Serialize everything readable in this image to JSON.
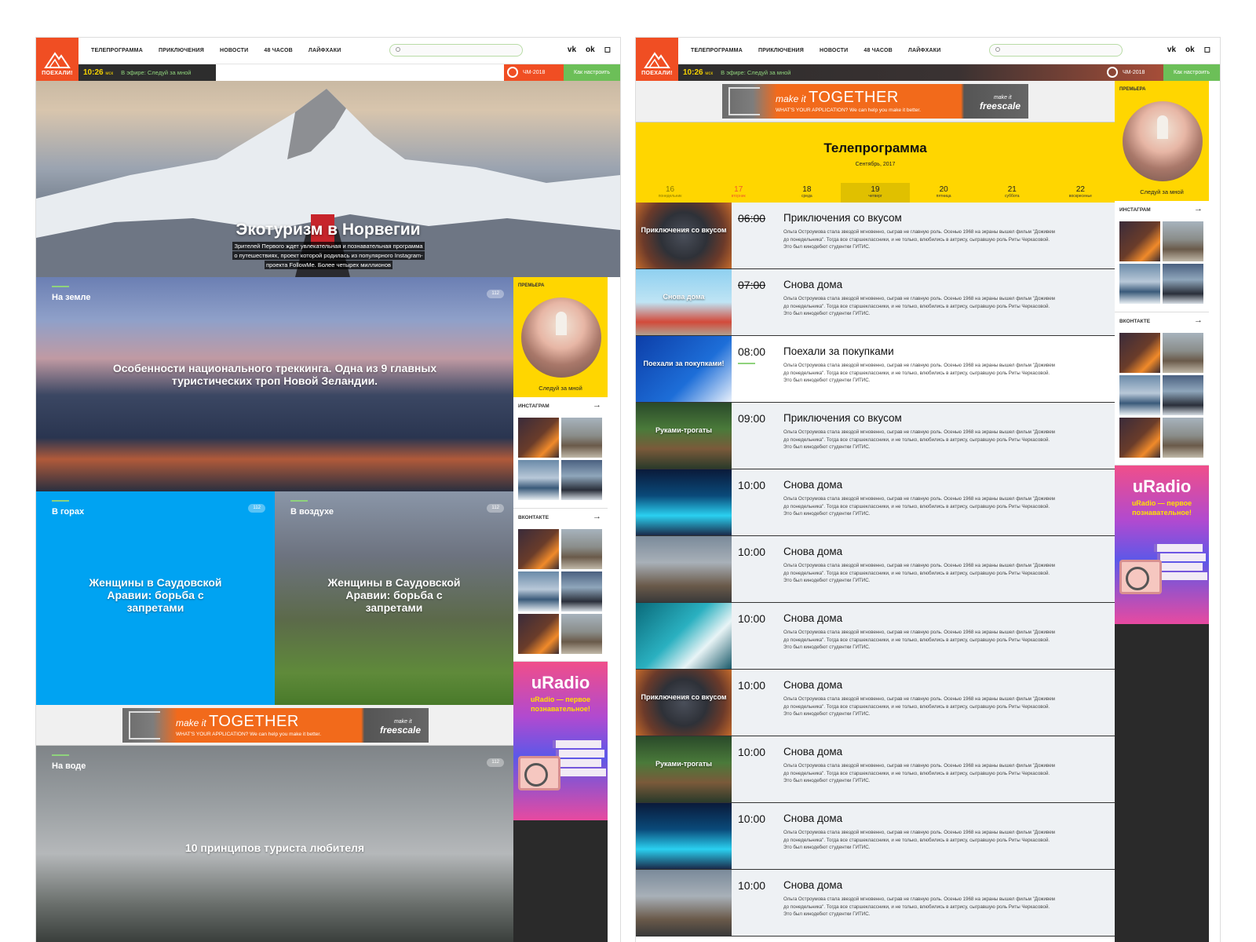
{
  "nav": {
    "logo_text": "ПОЕХАЛИ!",
    "menu": [
      "ТЕЛЕПРОГРАММА",
      "ПРИКЛЮЧЕНИЯ",
      "НОВОСТИ",
      "48 ЧАСОВ",
      "ЛАЙФХАКИ"
    ],
    "search_placeholder": "",
    "social": [
      "vk-icon",
      "odnoklassniki-icon",
      "instagram-icon"
    ]
  },
  "live": {
    "time": "10:26",
    "tz": "мск",
    "on_air": "В эфире: Следуй за мной",
    "cup": "ЧМ-2018",
    "setup": "Как настроить"
  },
  "home": {
    "hero": {
      "title": "Экотуризм в Норвегии",
      "text": "Зрителей Первого ждет увлекательная и познавательная программа о путешествиях, проект которой родилась из популярного Instagram-проекта FollowMe. Более четырех миллионов"
    },
    "tiles": {
      "land": {
        "label": "На земле",
        "count": "112",
        "title": "Особенности национального треккинга. Одна из 9 главных туристических троп Новой Зеландии."
      },
      "mountains": {
        "label": "В горах",
        "count": "112",
        "title": "Женщины в Саудовской Аравии: борьба с запретами"
      },
      "air": {
        "label": "В воздухе",
        "count": "112",
        "title": "Женщины в Саудовской Аравии: борьба с запретами"
      },
      "water": {
        "label": "На воде",
        "count": "112",
        "title": "10 принципов туриста любителя"
      }
    }
  },
  "ad": {
    "make_it": "make it",
    "together": "TOGETHER",
    "sub": "WHAT'S YOUR APPLICATION? We can help you make it better.",
    "brand_small": "make it",
    "brand": "freescale"
  },
  "sidebar": {
    "premiere_label": "ПРЕМЬЕРА",
    "premiere_title": "Следуй за мной",
    "instagram_label": "ИНСТАГРАМ",
    "vk_label": "ВКОНТАКТЕ",
    "radio_title": "uRadio",
    "radio_sub": "uRadio — первое познавательное!"
  },
  "tv": {
    "title": "Телепрограмма",
    "month": "Сентябрь, 2017",
    "days": [
      {
        "num": "16",
        "name": "понедельник",
        "state": "past"
      },
      {
        "num": "17",
        "name": "вторник",
        "state": "today"
      },
      {
        "num": "18",
        "name": "среда",
        "state": ""
      },
      {
        "num": "19",
        "name": "четверг",
        "state": "sel"
      },
      {
        "num": "20",
        "name": "пятница",
        "state": ""
      },
      {
        "num": "21",
        "name": "суббота",
        "state": ""
      },
      {
        "num": "22",
        "name": "воскресенье",
        "state": ""
      }
    ],
    "desc": "Ольга Остроумова стала звездой мгновенно, сыграв не главную роль. Осенью 1968 на экраны вышел фильм \"Доживем до понедельника\". Тогда все старшеклассники, и не только, влюбились в актрису, сыгравшую роль Риты Черкасовой. Это был кинодебют студентки ГИТИС.",
    "shows": [
      {
        "time": "06:00",
        "title": "Приключения со вкусом",
        "thumb": "Приключения со вкусом",
        "state": "past"
      },
      {
        "time": "07:00",
        "title": "Снова дома",
        "thumb": "Снова дома",
        "state": "past"
      },
      {
        "time": "08:00",
        "title": "Поехали за покупками",
        "thumb": "Поехали за покупками!",
        "state": "on"
      },
      {
        "time": "09:00",
        "title": "Приключения со вкусом",
        "thumb": "Руками-трогаты",
        "state": ""
      },
      {
        "time": "10:00",
        "title": "Снова дома",
        "thumb": "",
        "state": ""
      },
      {
        "time": "10:00",
        "title": "Снова дома",
        "thumb": "",
        "state": ""
      },
      {
        "time": "10:00",
        "title": "Снова дома",
        "thumb": "",
        "state": ""
      },
      {
        "time": "10:00",
        "title": "Снова дома",
        "thumb": "Приключения со вкусом",
        "state": ""
      },
      {
        "time": "10:00",
        "title": "Снова дома",
        "thumb": "Руками-трогаты",
        "state": ""
      },
      {
        "time": "10:00",
        "title": "Снова дома",
        "thumb": "",
        "state": ""
      },
      {
        "time": "10:00",
        "title": "Снова дома",
        "thumb": "",
        "state": ""
      }
    ]
  }
}
